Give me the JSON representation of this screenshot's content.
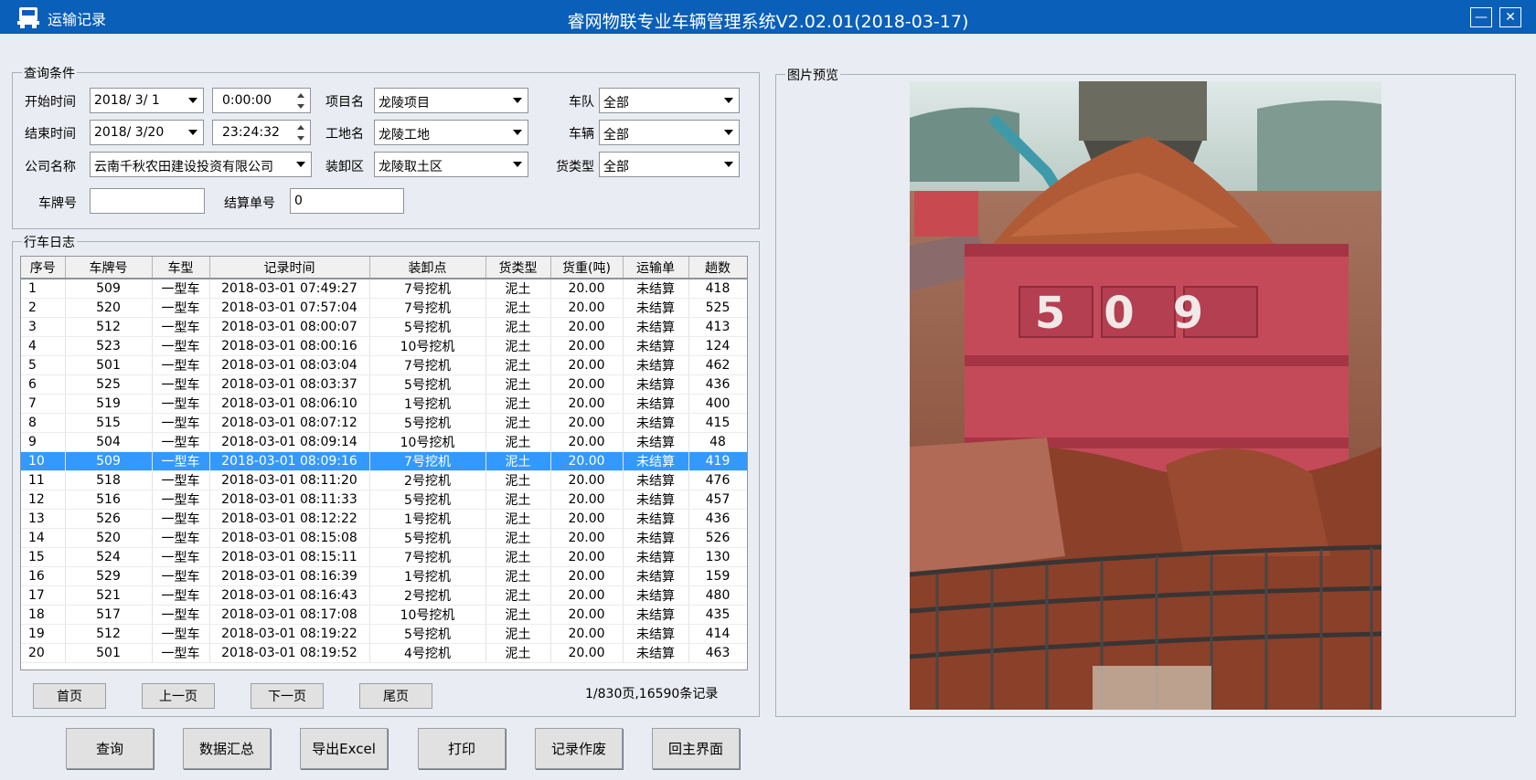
{
  "window": {
    "title": "运输记录",
    "system_title": "睿网物联专业车辆管理系统V2.02.01(2018-03-17)",
    "minimize_symbol": "—",
    "close_symbol": "✕"
  },
  "query": {
    "legend": "查询条件",
    "start_time_label": "开始时间",
    "start_date": "2018/  3/  1",
    "start_time": "0:00:00",
    "end_time_label": "结束时间",
    "end_date": "2018/  3/20",
    "end_time": "23:24:32",
    "company_label": "公司名称",
    "company": "云南千秋农田建设投资有限公司",
    "project_label": "项目名",
    "project": "龙陵项目",
    "site_label": "工地名",
    "site": "龙陵工地",
    "load_area_label": "装卸区",
    "load_area": "龙陵取土区",
    "fleet_label": "车队",
    "fleet": "全部",
    "vehicle_label": "车辆",
    "vehicle": "全部",
    "cargo_type_label": "货类型",
    "cargo_type": "全部",
    "plate_label": "车牌号",
    "plate": "",
    "settle_no_label": "结算单号",
    "settle_no": "0"
  },
  "log": {
    "legend": "行车日志",
    "columns": [
      "序号",
      "车牌号",
      "车型",
      "记录时间",
      "装卸点",
      "货类型",
      "货重(吨)",
      "运输单",
      "趟数"
    ],
    "selected_row": 9,
    "rows": [
      [
        "1",
        "509",
        "一型车",
        "2018-03-01 07:49:27",
        "7号挖机",
        "泥土",
        "20.00",
        "未结算",
        "418"
      ],
      [
        "2",
        "520",
        "一型车",
        "2018-03-01 07:57:04",
        "7号挖机",
        "泥土",
        "20.00",
        "未结算",
        "525"
      ],
      [
        "3",
        "512",
        "一型车",
        "2018-03-01 08:00:07",
        "5号挖机",
        "泥土",
        "20.00",
        "未结算",
        "413"
      ],
      [
        "4",
        "523",
        "一型车",
        "2018-03-01 08:00:16",
        "10号挖机",
        "泥土",
        "20.00",
        "未结算",
        "124"
      ],
      [
        "5",
        "501",
        "一型车",
        "2018-03-01 08:03:04",
        "7号挖机",
        "泥土",
        "20.00",
        "未结算",
        "462"
      ],
      [
        "6",
        "525",
        "一型车",
        "2018-03-01 08:03:37",
        "5号挖机",
        "泥土",
        "20.00",
        "未结算",
        "436"
      ],
      [
        "7",
        "519",
        "一型车",
        "2018-03-01 08:06:10",
        "1号挖机",
        "泥土",
        "20.00",
        "未结算",
        "400"
      ],
      [
        "8",
        "515",
        "一型车",
        "2018-03-01 08:07:12",
        "5号挖机",
        "泥土",
        "20.00",
        "未结算",
        "415"
      ],
      [
        "9",
        "504",
        "一型车",
        "2018-03-01 08:09:14",
        "10号挖机",
        "泥土",
        "20.00",
        "未结算",
        "48"
      ],
      [
        "10",
        "509",
        "一型车",
        "2018-03-01 08:09:16",
        "7号挖机",
        "泥土",
        "20.00",
        "未结算",
        "419"
      ],
      [
        "11",
        "518",
        "一型车",
        "2018-03-01 08:11:20",
        "2号挖机",
        "泥土",
        "20.00",
        "未结算",
        "476"
      ],
      [
        "12",
        "516",
        "一型车",
        "2018-03-01 08:11:33",
        "5号挖机",
        "泥土",
        "20.00",
        "未结算",
        "457"
      ],
      [
        "13",
        "526",
        "一型车",
        "2018-03-01 08:12:22",
        "1号挖机",
        "泥土",
        "20.00",
        "未结算",
        "436"
      ],
      [
        "14",
        "520",
        "一型车",
        "2018-03-01 08:15:08",
        "5号挖机",
        "泥土",
        "20.00",
        "未结算",
        "526"
      ],
      [
        "15",
        "524",
        "一型车",
        "2018-03-01 08:15:11",
        "7号挖机",
        "泥土",
        "20.00",
        "未结算",
        "130"
      ],
      [
        "16",
        "529",
        "一型车",
        "2018-03-01 08:16:39",
        "1号挖机",
        "泥土",
        "20.00",
        "未结算",
        "159"
      ],
      [
        "17",
        "521",
        "一型车",
        "2018-03-01 08:16:43",
        "2号挖机",
        "泥土",
        "20.00",
        "未结算",
        "480"
      ],
      [
        "18",
        "517",
        "一型车",
        "2018-03-01 08:17:08",
        "10号挖机",
        "泥土",
        "20.00",
        "未结算",
        "435"
      ],
      [
        "19",
        "512",
        "一型车",
        "2018-03-01 08:19:22",
        "5号挖机",
        "泥土",
        "20.00",
        "未结算",
        "414"
      ],
      [
        "20",
        "501",
        "一型车",
        "2018-03-01 08:19:52",
        "4号挖机",
        "泥土",
        "20.00",
        "未结算",
        "463"
      ]
    ]
  },
  "pager": {
    "first": "首页",
    "prev": "上一页",
    "next": "下一页",
    "last": "尾页",
    "info": "1/830页,16590条记录"
  },
  "actions": {
    "query": "查询",
    "summary": "数据汇总",
    "export": "导出Excel",
    "print": "打印",
    "void": "记录作废",
    "home": "回主界面"
  },
  "preview": {
    "legend": "图片预览",
    "truck_number": "509"
  },
  "colors": {
    "titlebar": "#0a5fb8",
    "selection": "#3399ff",
    "background": "#e9ecf2"
  }
}
